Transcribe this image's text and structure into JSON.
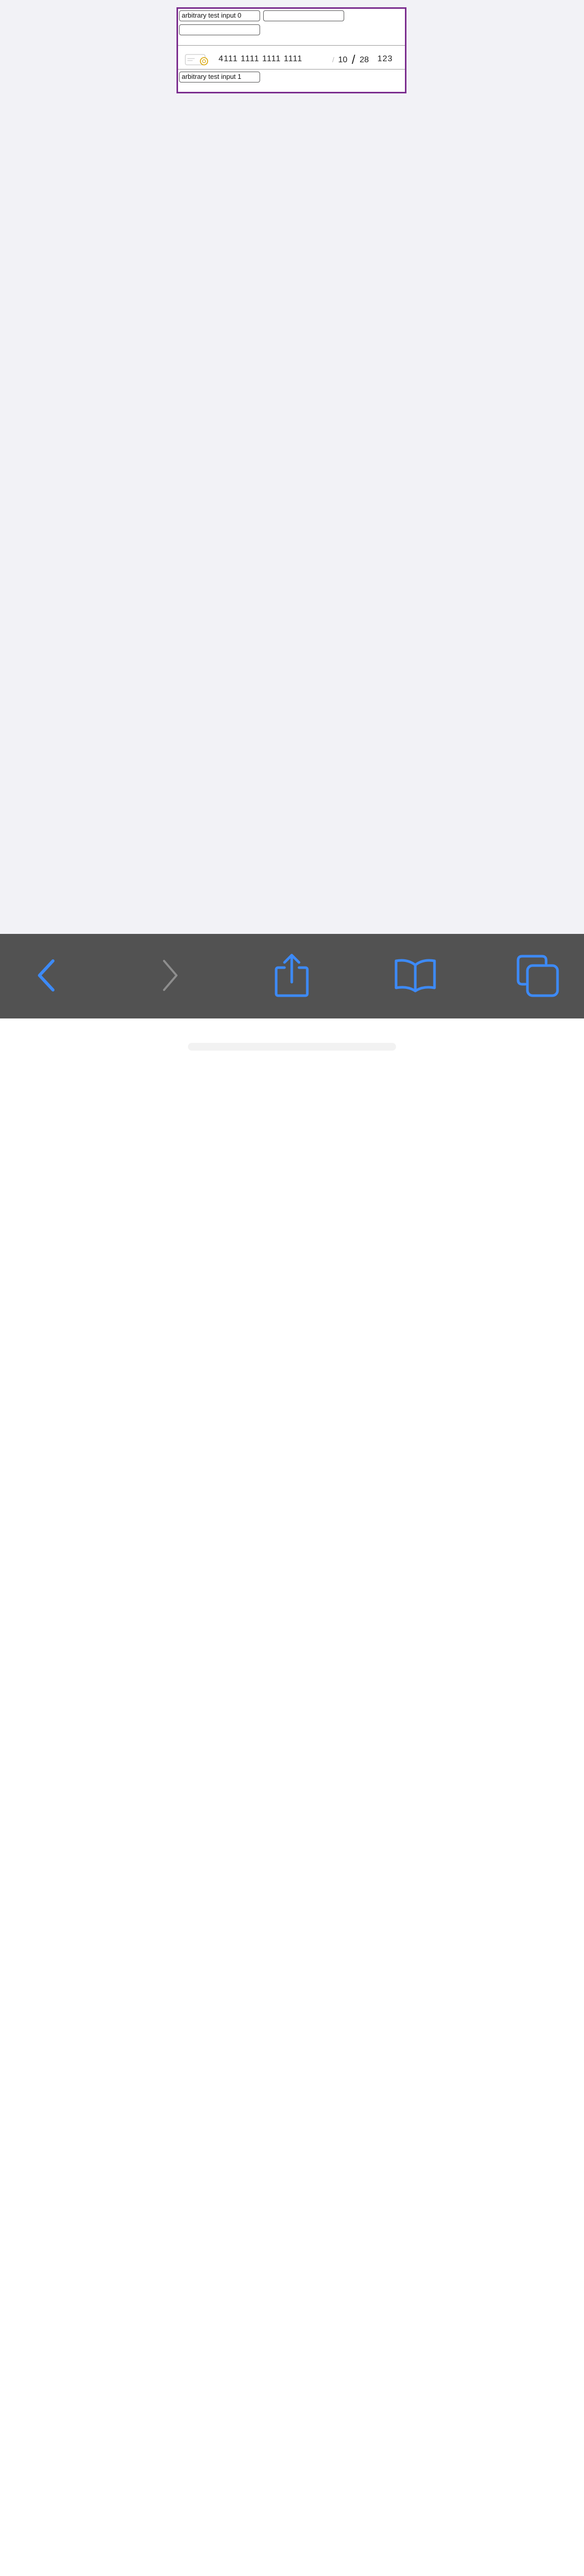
{
  "form": {
    "input_0_value": "arbitrary test input 0",
    "input_empty_a_value": "",
    "input_empty_b_value": "",
    "input_1_value": "arbitrary test input 1"
  },
  "card": {
    "number": "4111 1111 1111 1111",
    "expiry_month": "10",
    "expiry_separator": "/",
    "expiry_year": "28",
    "cvc": "123"
  },
  "toolbar": {
    "items": [
      {
        "icon": "back-chevron-icon",
        "enabled": true
      },
      {
        "icon": "forward-chevron-icon",
        "enabled": false
      },
      {
        "icon": "share-icon",
        "enabled": true
      },
      {
        "icon": "bookmarks-icon",
        "enabled": true
      },
      {
        "icon": "tabs-icon",
        "enabled": true
      }
    ]
  },
  "colors": {
    "frame_border": "#7b2d8e",
    "page_background": "#f2f2f6",
    "toolbar_background": "#525252",
    "accent_blue": "#3d8af7",
    "disabled_gray": "#8e8e8e"
  }
}
